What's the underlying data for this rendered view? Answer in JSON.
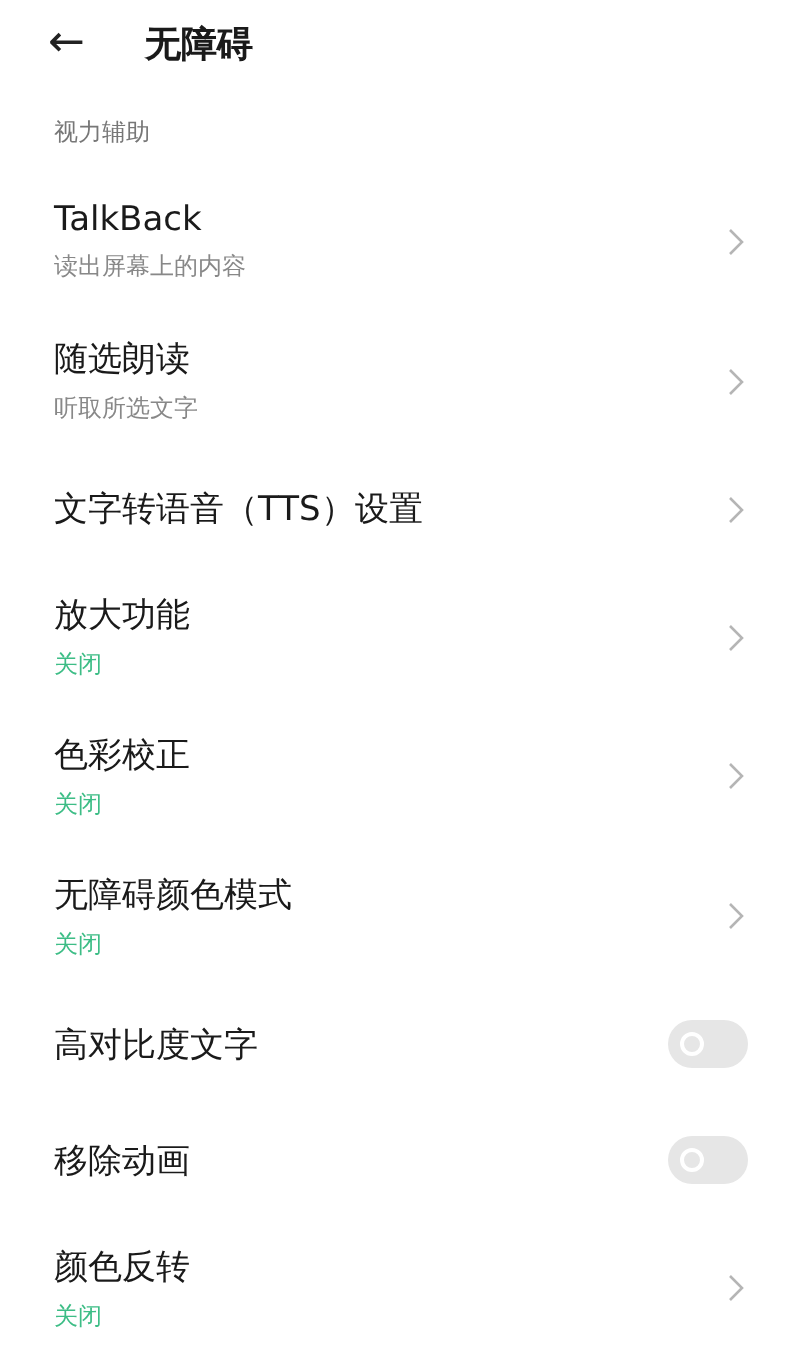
{
  "header": {
    "back": "←",
    "title": "无障碍"
  },
  "section": {
    "label": "视力辅助"
  },
  "items": [
    {
      "kind": "link",
      "title": "TalkBack",
      "subtitle": "读出屏幕上的内容"
    },
    {
      "kind": "link",
      "title": "随选朗读",
      "subtitle": "听取所选文字"
    },
    {
      "kind": "link",
      "title": "文字转语音（TTS）设置"
    },
    {
      "kind": "link",
      "title": "放大功能",
      "status": "关闭"
    },
    {
      "kind": "link",
      "title": "色彩校正",
      "status": "关闭"
    },
    {
      "kind": "link",
      "title": "无障碍颜色模式",
      "status": "关闭"
    },
    {
      "kind": "toggle",
      "title": "高对比度文字",
      "on": false
    },
    {
      "kind": "toggle",
      "title": "移除动画",
      "on": false
    },
    {
      "kind": "link",
      "title": "颜色反转",
      "status": "关闭"
    }
  ]
}
